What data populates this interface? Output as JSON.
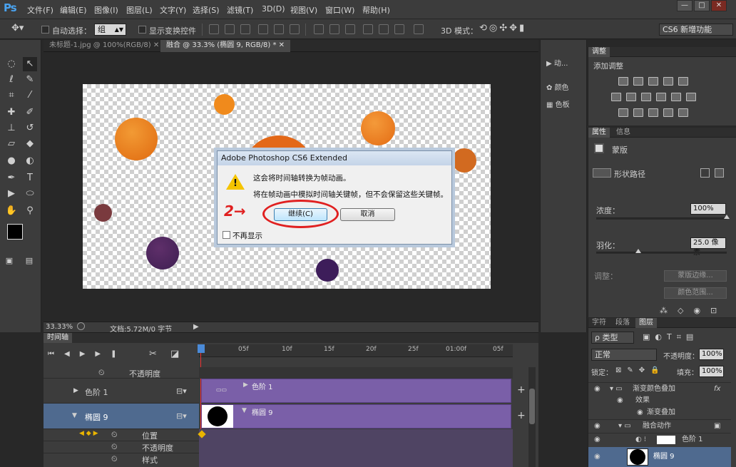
{
  "menubar": {
    "logo": "Ps",
    "items": [
      "文件(F)",
      "编辑(E)",
      "图像(I)",
      "图层(L)",
      "文字(Y)",
      "选择(S)",
      "滤镜(T)",
      "3D(D)",
      "视图(V)",
      "窗口(W)",
      "帮助(H)"
    ],
    "win_minimize": "—",
    "win_restore": "□",
    "win_close": "✕"
  },
  "options": {
    "auto_select_label": "自动选择：",
    "auto_select_value": "组",
    "show_transform_label": "显示变换控件",
    "mode_3d_label": "3D 模式：",
    "workspace": "CS6 新增功能"
  },
  "tabs": [
    {
      "label": "未标题-1.jpg @ 100%(RGB/8)",
      "close": "✕"
    },
    {
      "label": "融合 @ 33.3% (椭圆 9, RGB/8) *",
      "close": "✕"
    }
  ],
  "status": {
    "zoom": "33.33%",
    "doc": "文档:5.72M/0 字节",
    "arrow": "▶"
  },
  "dialog": {
    "title": "Adobe Photoshop CS6 Extended",
    "line1": "这会将时间轴转换为帧动画。",
    "line2": "将在帧动画中模拟时间轴关键帧，但不会保留这些关键帧。",
    "continue_label": "继续(C)",
    "cancel_label": "取消",
    "dont_show_label": "不再显示",
    "annotation": "2→"
  },
  "strip": {
    "items": [
      {
        "label": "动...",
        "icon": "play-icon"
      },
      {
        "label": "颜色",
        "icon": "palette-icon"
      },
      {
        "label": "色板",
        "icon": "swatches-icon"
      }
    ]
  },
  "adjustments": {
    "tabs": [
      "调整"
    ],
    "title": "添加调整"
  },
  "properties": {
    "tabs": [
      "属性",
      "信息"
    ],
    "mask_label": "蒙版",
    "shape_path_label": "形状路径",
    "density_label": "浓度：",
    "density_value": "100%",
    "density_level": 1.0,
    "feather_label": "羽化：",
    "feather_value": "25.0 像素",
    "feather_level": 0.32,
    "adjust_label": "调整：",
    "mask_edge_btn": "蒙版边缘...",
    "color_range_btn": "颜色范围..."
  },
  "layers": {
    "tabs": [
      "字符",
      "段落",
      "图层"
    ],
    "filter_label": "ρ 类型",
    "blend_mode": "正常",
    "opacity_label": "不透明度：",
    "opacity_value": "100%",
    "lock_label": "锁定：",
    "fill_label": "填充：",
    "fill_value": "100%",
    "rows": [
      {
        "name": "渐变颜色叠加",
        "fx": "fx"
      },
      {
        "name": "效果"
      },
      {
        "name": "渐变叠加"
      },
      {
        "name": "融合动作"
      },
      {
        "name": "色阶 1"
      },
      {
        "name": "椭圆 9"
      }
    ]
  },
  "timeline": {
    "title": "时间轴",
    "ticks": [
      "05f",
      "10f",
      "15f",
      "20f",
      "25f",
      "01:00f",
      "05f"
    ],
    "tracks": [
      {
        "label": "不透明度"
      },
      {
        "label": "色阶 1",
        "bar_label": "色阶 1"
      },
      {
        "label": "椭圆 9",
        "bar_label": "椭圆 9"
      },
      {
        "label": "位置"
      },
      {
        "label": "不透明度"
      },
      {
        "label": "样式"
      }
    ]
  },
  "colors": {
    "accent": "#7a5fa8",
    "annotation_red": "#e02020",
    "selected_row": "#4f6a8f"
  }
}
